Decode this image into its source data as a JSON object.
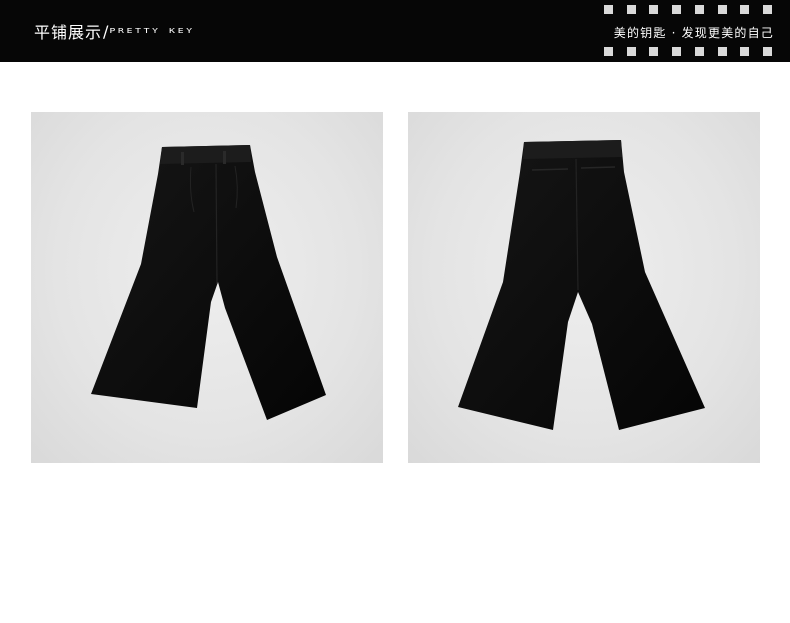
{
  "header": {
    "title_cn": "平铺展示",
    "title_separator": "/",
    "title_en": "PRETTY KEY",
    "slogan": "美的钥匙 · 发现更美的自己",
    "dots_per_row": 8
  },
  "photos": [
    {
      "view": "front",
      "subject": "black wide-leg culotte pants"
    },
    {
      "view": "back",
      "subject": "black wide-leg culotte pants"
    }
  ],
  "colors": {
    "header_bg": "#060606",
    "dot": "#d9d9d9",
    "photo_bg": "#e6e6e6",
    "garment": "#0b0b0b"
  }
}
